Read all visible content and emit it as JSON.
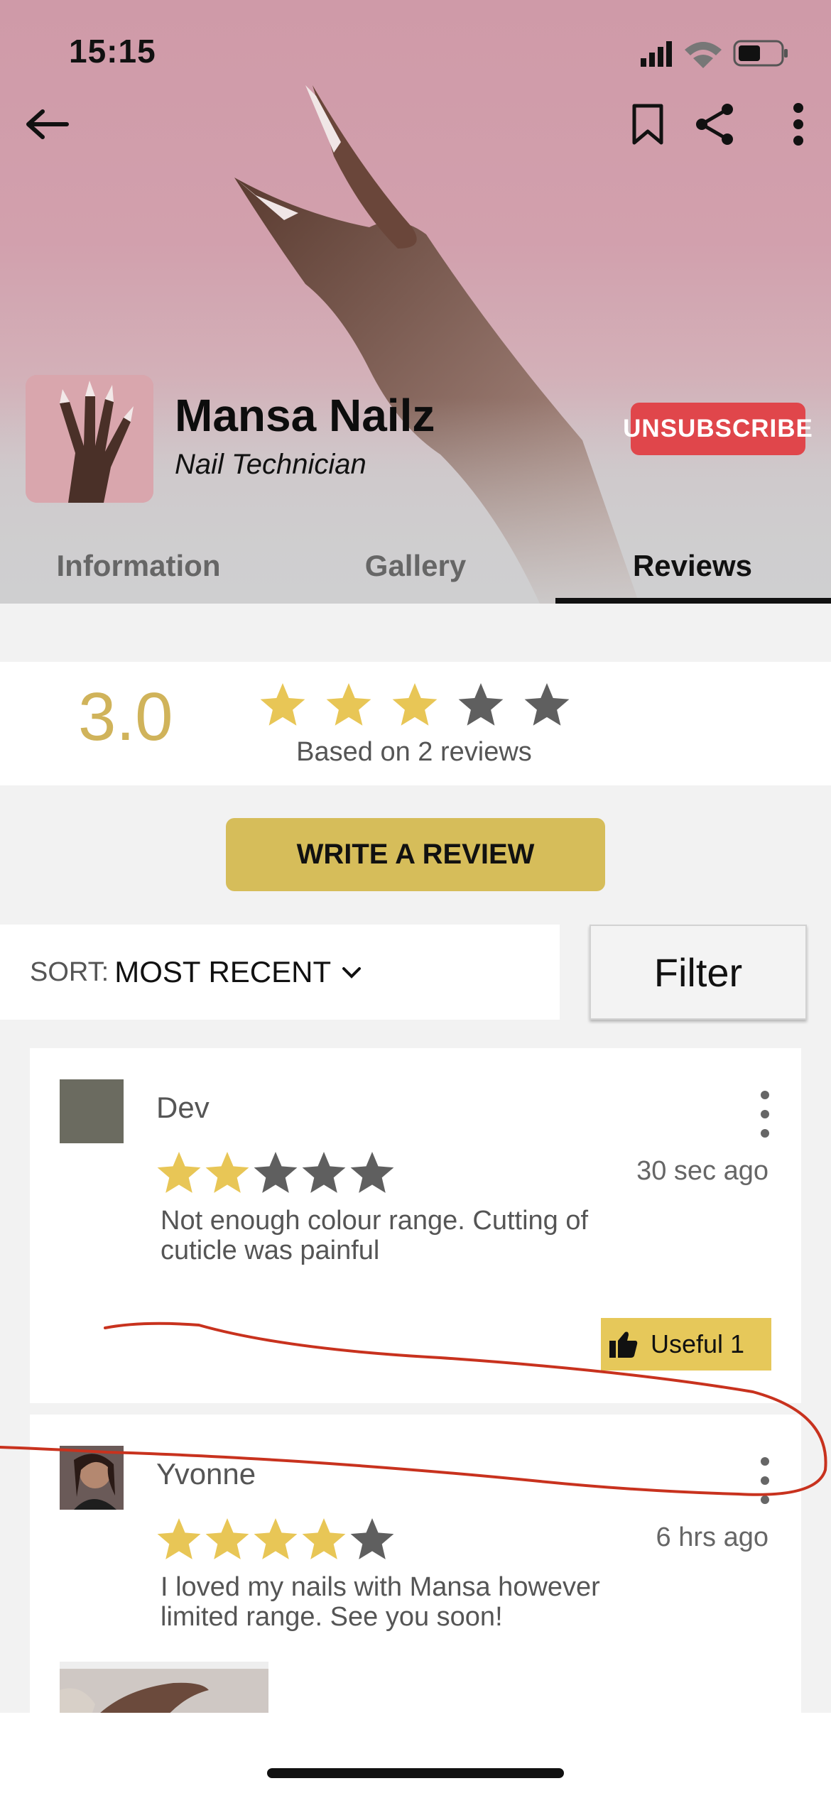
{
  "status_bar": {
    "time": "15:15"
  },
  "profile": {
    "name": "Mansa Nailz",
    "role": "Nail Technician",
    "unsubscribe_label": "UNSUBSCRIBE"
  },
  "tabs": [
    {
      "label": "Information",
      "active": false
    },
    {
      "label": "Gallery",
      "active": false
    },
    {
      "label": "Reviews",
      "active": true
    }
  ],
  "rating": {
    "average": "3.0",
    "stars_filled": 3,
    "stars_total": 5,
    "based_on": "Based on 2 reviews"
  },
  "write_review_label": "WRITE A REVIEW",
  "sort": {
    "label": "SORT:",
    "value": "MOST RECENT"
  },
  "filter_label": "Filter",
  "reviews": [
    {
      "name": "Dev",
      "stars_filled": 2,
      "time": "30 sec ago",
      "text": "Not enough colour range. Cutting of cuticle was painful",
      "useful_label": "Useful 1"
    },
    {
      "name": "Yvonne",
      "stars_filled": 4,
      "time": "6 hrs ago",
      "text": "I loved my nails with Mansa however limited range. See you soon!"
    }
  ],
  "colors": {
    "accent_gold": "#d6bd5a",
    "star_gold": "#e8c656",
    "star_gray": "#5f5f5f",
    "unsubscribe_red": "#e0464b",
    "annotation_red": "#c8321e"
  },
  "icons": [
    "back-arrow-icon",
    "bookmark-icon",
    "share-icon",
    "more-vertical-icon",
    "chevron-down-icon",
    "thumbs-up-icon",
    "star-icon"
  ]
}
